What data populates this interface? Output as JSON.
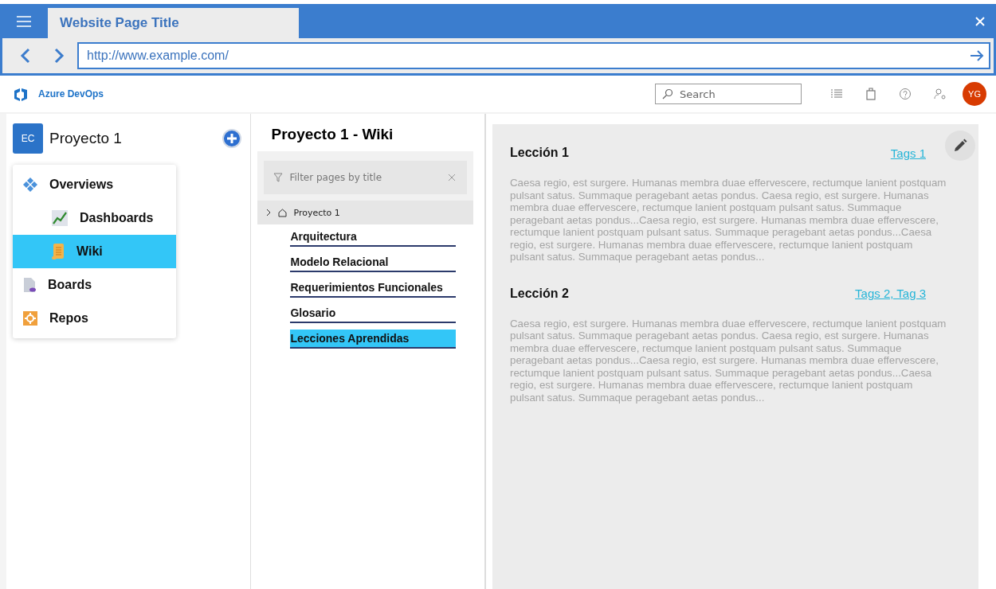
{
  "browser": {
    "tab_title": "Website Page Title",
    "url": "http://www.example.com/"
  },
  "header": {
    "brand": "Azure DevOps",
    "search": {
      "placeholder": "Search"
    },
    "avatar": "YG"
  },
  "project": {
    "badge": "EC",
    "name": "Proyecto 1"
  },
  "nav": [
    {
      "label": "Overviews",
      "selected": false,
      "children": [
        {
          "label": "Dashboards",
          "selected": false
        },
        {
          "label": "Wiki",
          "selected": true
        }
      ]
    },
    {
      "label": "Boards",
      "selected": false
    },
    {
      "label": "Repos",
      "selected": false
    }
  ],
  "wiki": {
    "title": "Proyecto 1 - Wiki",
    "filter": {
      "placeholder": "Filter pages by title"
    },
    "root": {
      "label": "Proyecto 1",
      "expanded": false
    },
    "pages": [
      {
        "label": "Arquitectura",
        "selected": false
      },
      {
        "label": "Modelo Relacional",
        "selected": false
      },
      {
        "label": "Requerimientos Funcionales",
        "selected": false
      },
      {
        "label": "Glosario",
        "selected": false
      },
      {
        "label": "Lecciones Aprendidas",
        "selected": true
      }
    ]
  },
  "lessons": [
    {
      "title": "Lección 1",
      "tags": "Tags 1",
      "text": "Caesa regio, est surgere. Humanas membra duae effervescere, rectumque lanient postquam pulsant satus. Summaque peragebant aetas pondus. Caesa regio, est surgere. Humanas membra duae effervescere, rectumque lanient postquam pulsant satus. Summaque peragebant aetas pondus...Caesa regio, est surgere. Humanas membra duae effervescere, rectumque lanient postquam pulsant satus. Summaque peragebant aetas pondus...Caesa regio, est surgere. Humanas membra duae effervescere, rectumque lanient postquam pulsant satus. Summaque peragebant aetas pondus..."
    },
    {
      "title": "Lección 2",
      "tags": "Tags 2, Tag 3",
      "text": "Caesa regio, est surgere. Humanas membra duae effervescere, rectumque lanient postquam pulsant satus. Summaque peragebant aetas pondus. Caesa regio, est surgere. Humanas membra duae effervescere, rectumque lanient postquam pulsant satus. Summaque peragebant aetas pondus...Caesa regio, est surgere. Humanas membra duae effervescere, rectumque lanient postquam pulsant satus. Summaque peragebant aetas pondus...Caesa regio, est surgere. Humanas membra duae effervescere, rectumque lanient postquam pulsant satus. Summaque peragebant aetas pondus..."
    }
  ]
}
